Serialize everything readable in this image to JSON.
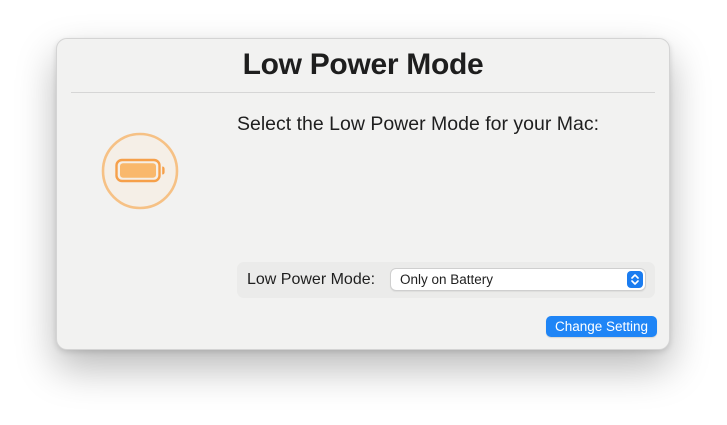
{
  "dialog": {
    "title": "Low Power Mode",
    "prompt": "Select the Low Power Mode for your Mac:",
    "icon": "battery-icon",
    "mode": {
      "label": "Low Power Mode:",
      "selected_value": "Only on Battery"
    },
    "change_button_label": "Change Setting"
  },
  "colors": {
    "accent": "#1f85f6",
    "battery_orange": "#f7b46a",
    "background": "#f2f2f1"
  }
}
